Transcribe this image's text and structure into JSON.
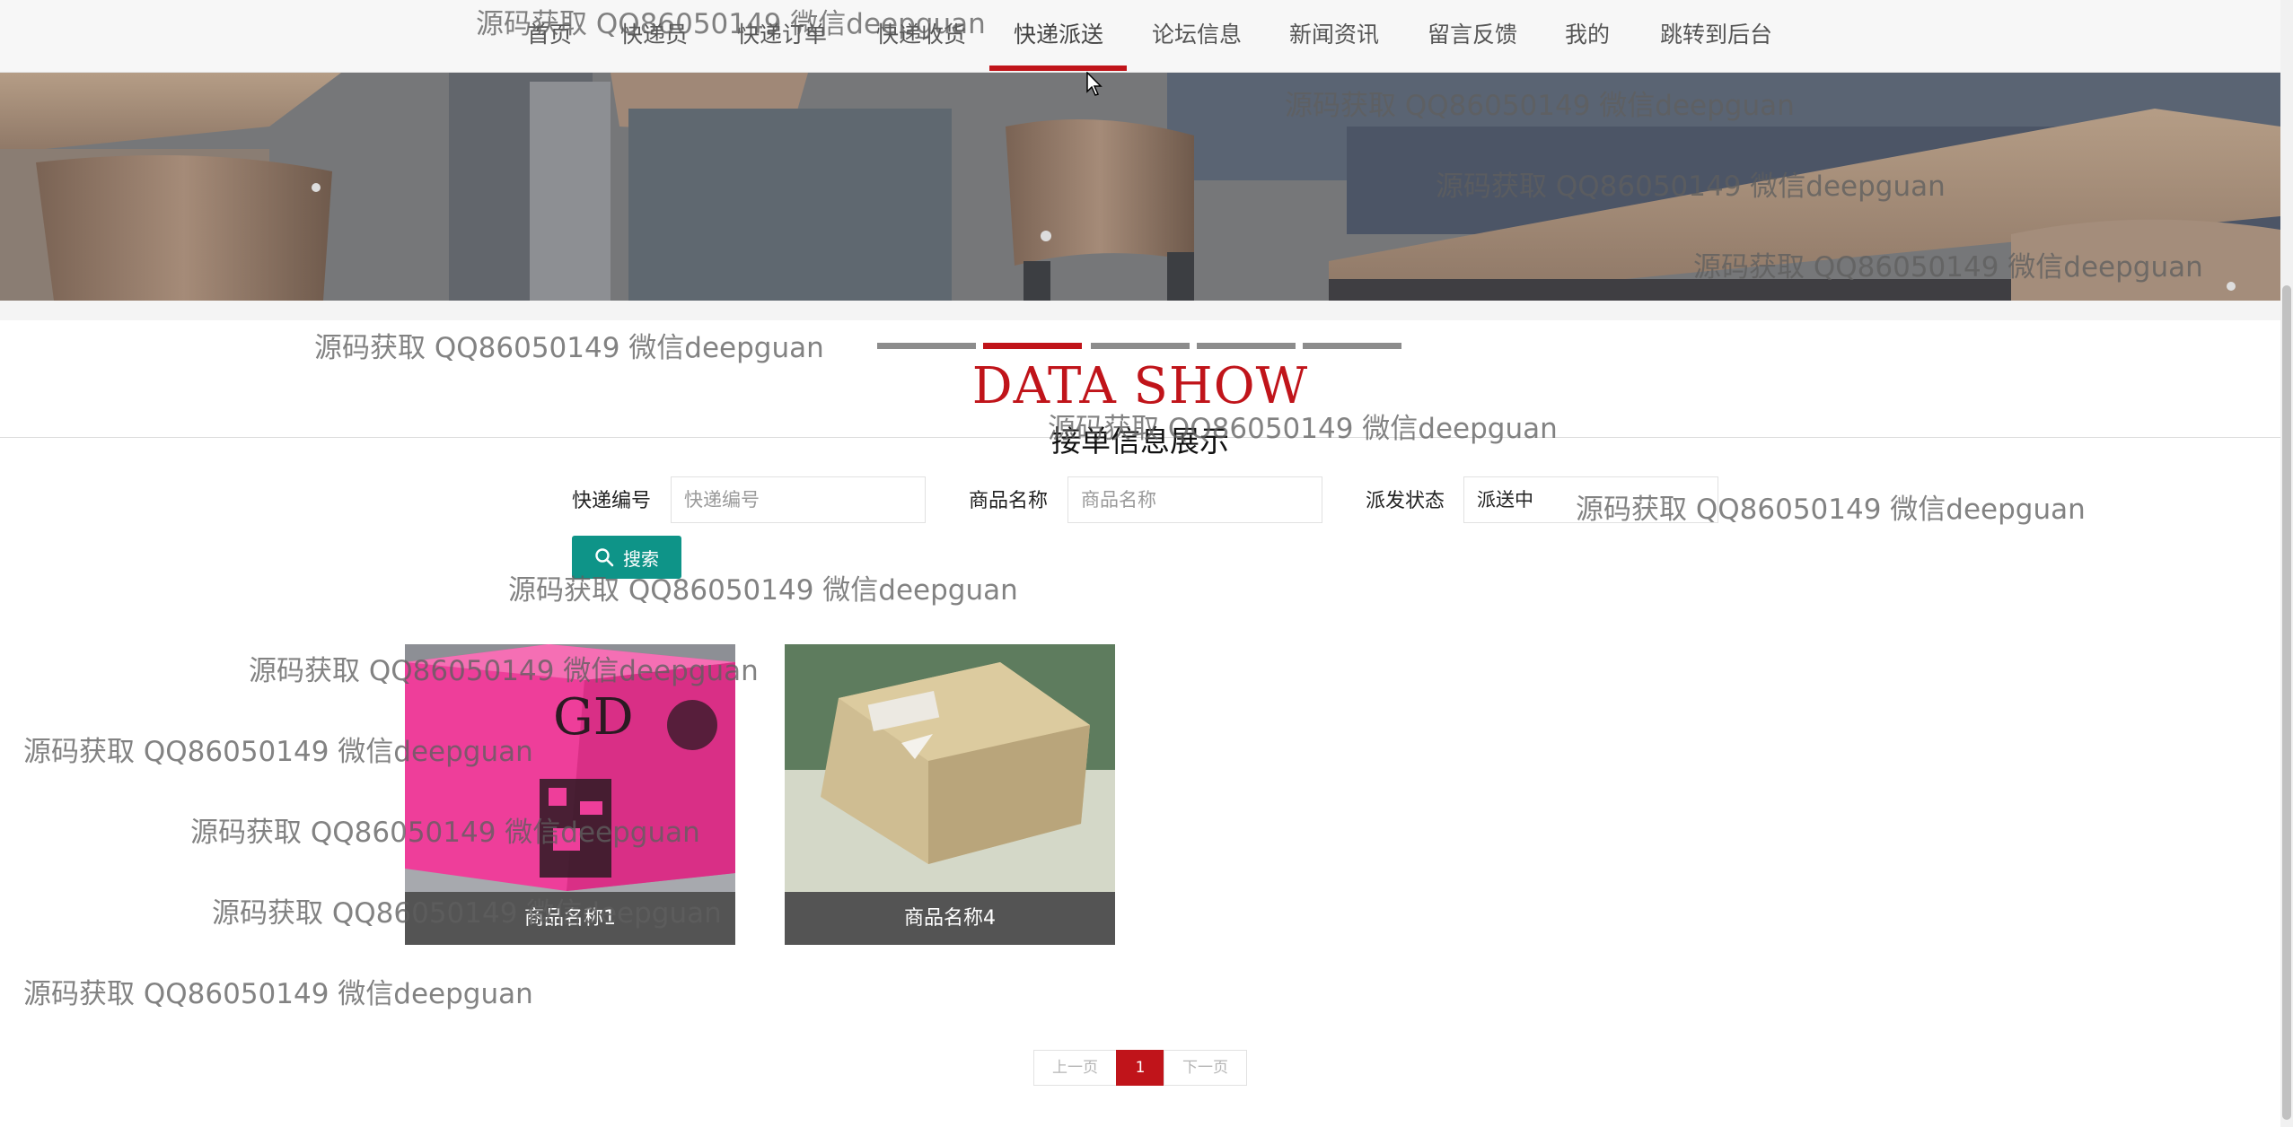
{
  "nav": {
    "items": [
      {
        "label": "首页"
      },
      {
        "label": "快递员"
      },
      {
        "label": "快递订单"
      },
      {
        "label": "快递收货"
      },
      {
        "label": "快递派送"
      },
      {
        "label": "论坛信息"
      },
      {
        "label": "新闻资讯"
      },
      {
        "label": "留言反馈"
      },
      {
        "label": "我的"
      },
      {
        "label": "跳转到后台"
      }
    ],
    "active": "快递派送"
  },
  "carousel": {
    "slide_count": 5,
    "active_index": 1
  },
  "section": {
    "heading": "DATA SHOW",
    "subtitle": "接单信息展示"
  },
  "search": {
    "code_label": "快递编号",
    "code_placeholder": "快递编号",
    "name_label": "商品名称",
    "name_placeholder": "商品名称",
    "status_label": "派发状态",
    "status_value": "派送中",
    "button_label": "搜索"
  },
  "products": [
    {
      "name": "商品名称1"
    },
    {
      "name": "商品名称4"
    }
  ],
  "pagination": {
    "prev": "上一页",
    "current": "1",
    "next": "下一页"
  },
  "watermark": {
    "text": "源码获取 QQ86050149 微信deepguan"
  },
  "colors": {
    "accent": "#c0141a",
    "button": "#0e9488",
    "caption_bg": "#545454"
  }
}
